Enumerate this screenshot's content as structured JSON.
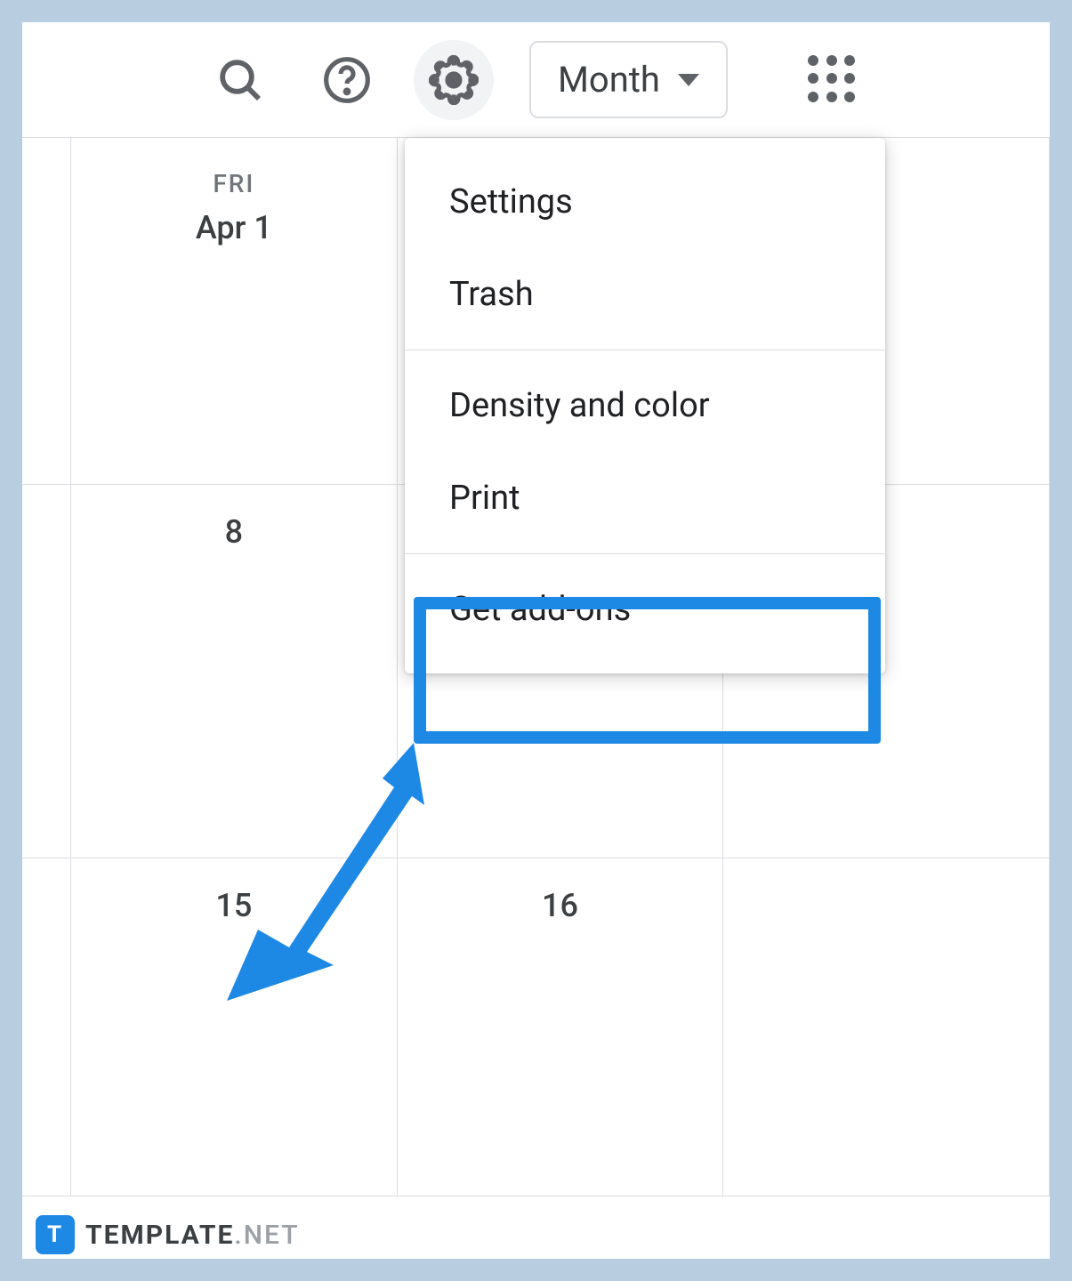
{
  "toolbar": {
    "view_label": "Month"
  },
  "calendar": {
    "day_header": "FRI",
    "cells": [
      {
        "label": "Apr 1"
      },
      {
        "label": "8"
      },
      {
        "label": "15"
      },
      {
        "label": "16"
      }
    ]
  },
  "dropdown": {
    "items": [
      {
        "label": "Settings"
      },
      {
        "label": "Trash"
      },
      {
        "label": "Density and color"
      },
      {
        "label": "Print"
      },
      {
        "label": "Get add-ons"
      }
    ]
  },
  "watermark": {
    "logo_letter": "T",
    "brand_main": "TEMPLATE",
    "brand_sub": ".NET"
  }
}
